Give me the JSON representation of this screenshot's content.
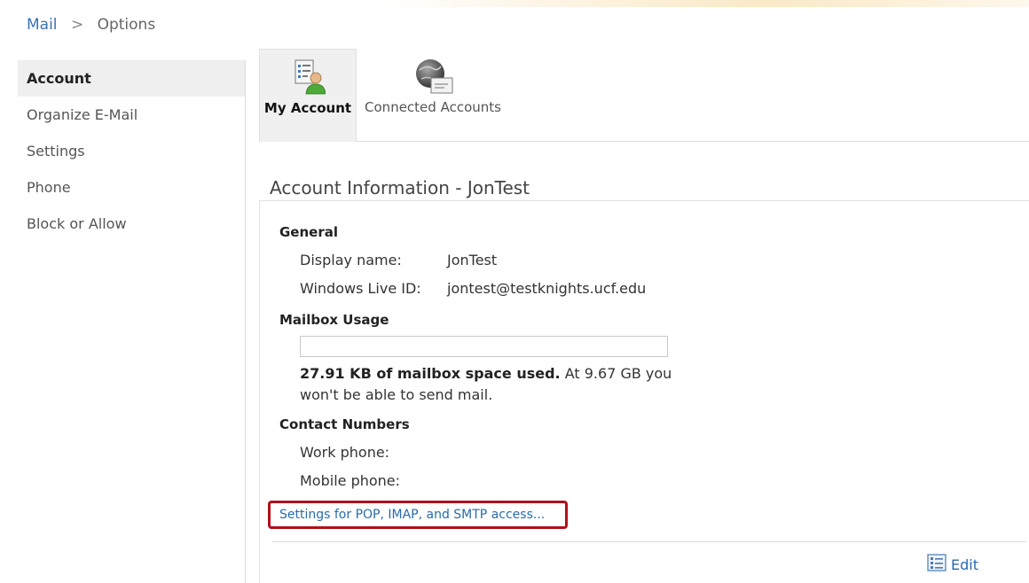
{
  "breadcrumb": {
    "root": "Mail",
    "separator": ">",
    "current": "Options"
  },
  "sidebar": {
    "items": [
      {
        "label": "Account",
        "active": true
      },
      {
        "label": "Organize E-Mail",
        "active": false
      },
      {
        "label": "Settings",
        "active": false
      },
      {
        "label": "Phone",
        "active": false
      },
      {
        "label": "Block or Allow",
        "active": false
      }
    ]
  },
  "tabs": [
    {
      "label": "My Account",
      "icon": "account-card-icon",
      "active": true
    },
    {
      "label": "Connected Accounts",
      "icon": "globe-envelope-icon",
      "active": false
    }
  ],
  "section": {
    "title": "Account Information - JonTest"
  },
  "general": {
    "heading": "General",
    "display_name_label": "Display name:",
    "display_name_value": "JonTest",
    "live_id_label": "Windows Live ID:",
    "live_id_value": "jontest@testknights.ucf.edu"
  },
  "mailbox": {
    "heading": "Mailbox Usage",
    "usage_fraction": 0.0,
    "used_amount": "27.91 KB of mailbox space used.",
    "limit_text": "At 9.67 GB you won't be able to send mail."
  },
  "contact": {
    "heading": "Contact Numbers",
    "work_label": "Work phone:",
    "mobile_label": "Mobile phone:"
  },
  "links": {
    "pop_imap": "Settings for POP, IMAP, and SMTP access..."
  },
  "actions": {
    "edit": "Edit",
    "edit_icon": "list-edit-icon"
  },
  "colors": {
    "link": "#2a6aab",
    "highlight_box": "#b0101c",
    "active_bg": "#efefef"
  }
}
